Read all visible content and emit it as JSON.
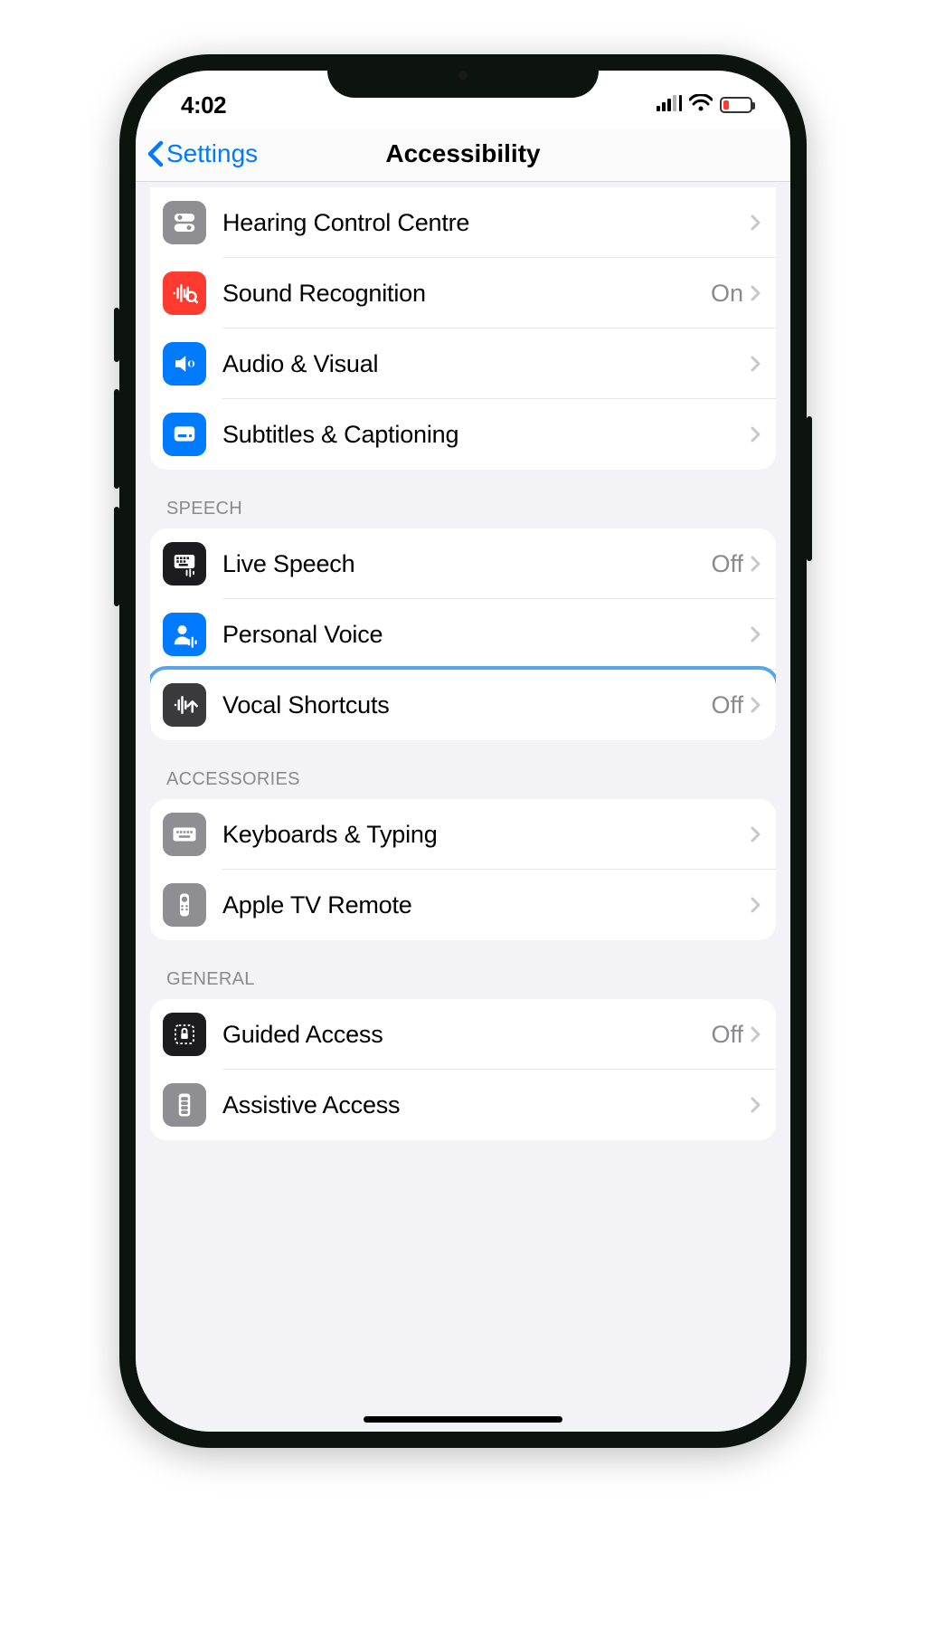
{
  "status": {
    "time": "4:02"
  },
  "nav": {
    "back_label": "Settings",
    "title": "Accessibility"
  },
  "sections": {
    "top": {
      "items": [
        {
          "label": "Hearing Control Centre",
          "value": ""
        },
        {
          "label": "Sound Recognition",
          "value": "On"
        },
        {
          "label": "Audio & Visual",
          "value": ""
        },
        {
          "label": "Subtitles & Captioning",
          "value": ""
        }
      ]
    },
    "speech": {
      "header": "Speech",
      "items": [
        {
          "label": "Live Speech",
          "value": "Off"
        },
        {
          "label": "Personal Voice",
          "value": ""
        },
        {
          "label": "Vocal Shortcuts",
          "value": "Off"
        }
      ]
    },
    "accessories": {
      "header": "Accessories",
      "items": [
        {
          "label": "Keyboards & Typing",
          "value": ""
        },
        {
          "label": "Apple TV Remote",
          "value": ""
        }
      ]
    },
    "general": {
      "header": "General",
      "items": [
        {
          "label": "Guided Access",
          "value": "Off"
        },
        {
          "label": "Assistive Access",
          "value": ""
        }
      ]
    }
  }
}
